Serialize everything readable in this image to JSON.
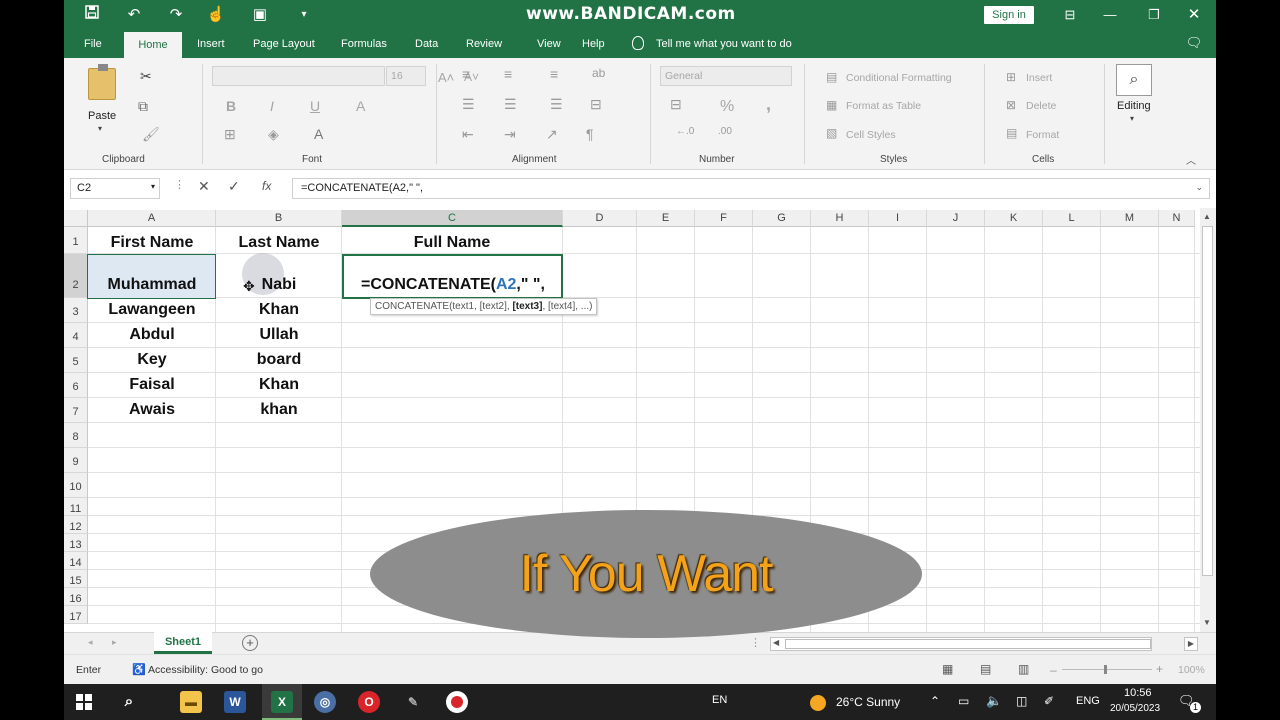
{
  "watermark": "www.BANDICAM.com",
  "titlebar": {
    "signin": "Sign in"
  },
  "tabs": {
    "file": "File",
    "home": "Home",
    "insert": "Insert",
    "page_layout": "Page Layout",
    "formulas": "Formulas",
    "data": "Data",
    "review": "Review",
    "view": "View",
    "help": "Help",
    "tell_me": "Tell me what you want to do"
  },
  "ribbon": {
    "clipboard": {
      "paste": "Paste",
      "label": "Clipboard"
    },
    "font": {
      "size": "16",
      "bold": "B",
      "italic": "I",
      "underline": "U",
      "font_a": "A",
      "label": "Font"
    },
    "alignment": {
      "label": "Alignment"
    },
    "number": {
      "format": "General",
      "percent": "%",
      "comma": ",",
      "label": "Number"
    },
    "styles": {
      "conditional": "Conditional Formatting",
      "format_table": "Format as Table",
      "cell_styles": "Cell Styles",
      "label": "Styles"
    },
    "cells": {
      "insert": "Insert",
      "delete": "Delete",
      "format": "Format",
      "label": "Cells"
    },
    "editing": {
      "label": "Editing"
    }
  },
  "formula_bar": {
    "name_box": "C2",
    "fx": "fx",
    "formula": "=CONCATENATE(A2,\" \","
  },
  "columns": [
    "A",
    "B",
    "C",
    "D",
    "E",
    "F",
    "G",
    "H",
    "I",
    "J",
    "K",
    "L",
    "M",
    "N"
  ],
  "rows": [
    "1",
    "2",
    "3",
    "4",
    "5",
    "6",
    "7",
    "8",
    "9",
    "10",
    "11",
    "12",
    "13",
    "14",
    "15",
    "16",
    "17"
  ],
  "cells": {
    "a1": "First Name",
    "b1": "Last Name",
    "c1": "Full Name",
    "a2": "Muhammad",
    "b2": "Nabi",
    "c2_prefix": "=CONCATENATE(",
    "c2_ref": "A2",
    "c2_suffix": ",\" \",",
    "a3": "Lawangeen",
    "b3": "Khan",
    "a4": "Abdul",
    "b4": "Ullah",
    "a5": "Key",
    "b5": "board",
    "a6": "Faisal",
    "b6": "Khan",
    "a7": "Awais",
    "b7": "khan"
  },
  "tooltip": {
    "text1": "CONCATENATE(text1, [text2], ",
    "text3": "[text3]",
    "text4": ", [text4], ...)"
  },
  "sheet": {
    "tab": "Sheet1",
    "add": "+"
  },
  "status": {
    "mode": "Enter",
    "accessibility": "Accessibility: Good to go",
    "zoom": "100%"
  },
  "overlay": {
    "text": "If  You Want"
  },
  "taskbar": {
    "lang_en": "EN",
    "weather": "26°C  Sunny",
    "eng": "ENG",
    "time": "10:56",
    "date": "20/05/2023",
    "notif": "1"
  },
  "colors": {
    "excel_green": "#217346",
    "overlay_gray": "#8d8d8d",
    "overlay_text": "#f4a21a",
    "ref_blue": "#2e75b6"
  }
}
